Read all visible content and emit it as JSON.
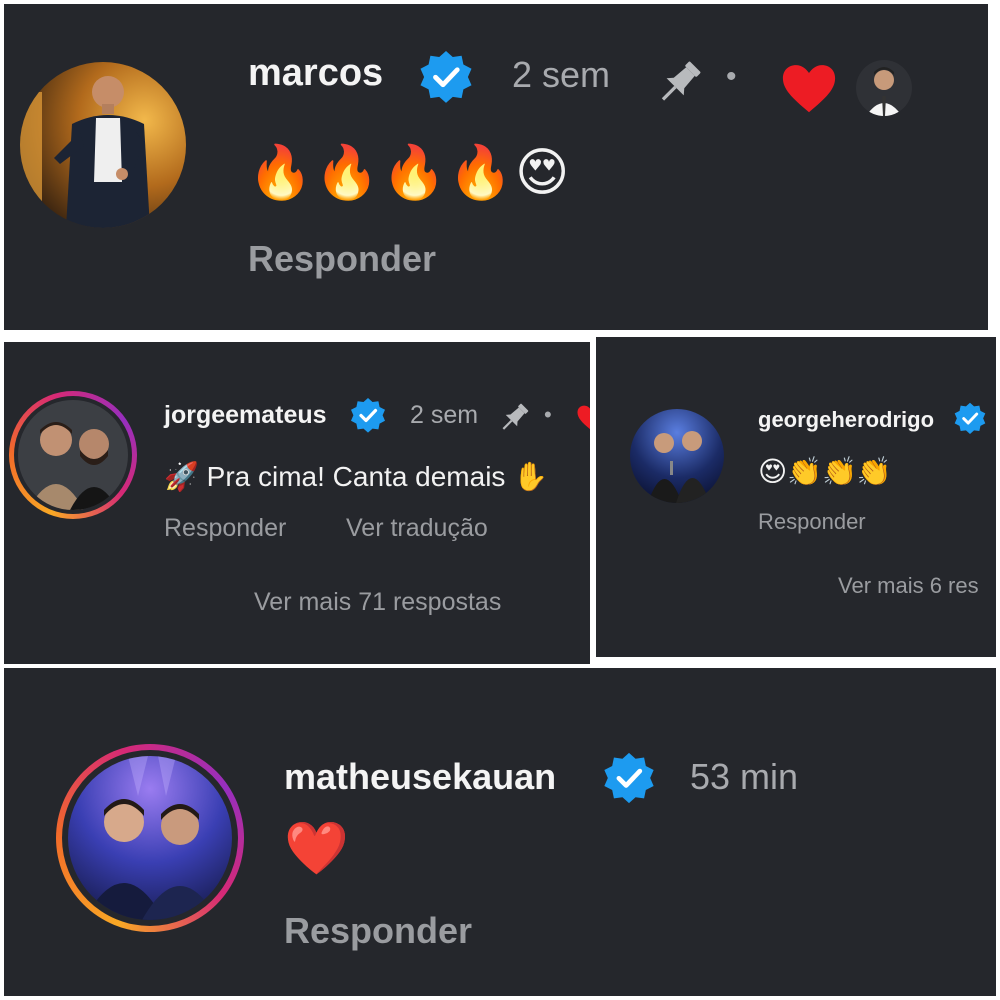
{
  "comments": [
    {
      "username": "marcos",
      "time": "2 sem",
      "separator": "•",
      "text": "🔥🔥🔥🔥😍",
      "reply": "Responder"
    },
    {
      "username": "jorgeemateus",
      "time": "2 sem",
      "separator": "•",
      "text": "🚀 Pra cima! Canta demais ✋",
      "reply": "Responder",
      "translate": "Ver tradução",
      "more_replies": "Ver mais 71 respostas"
    },
    {
      "username": "georgeherodrigo",
      "text": "😍👏👏👏",
      "reply": "Responder",
      "more_replies": "Ver mais 6 res"
    },
    {
      "username": "matheusekauan",
      "time": "53 min",
      "text": "❤️",
      "reply": "Responder"
    }
  ],
  "icons": {
    "verified": "verified-badge-icon",
    "pin": "pin-icon",
    "like": "heart-icon"
  },
  "colors": {
    "background": "#25272c",
    "verified": "#1d9bf0",
    "like": "#ed1c24",
    "secondary_text": "#a8aaae"
  }
}
